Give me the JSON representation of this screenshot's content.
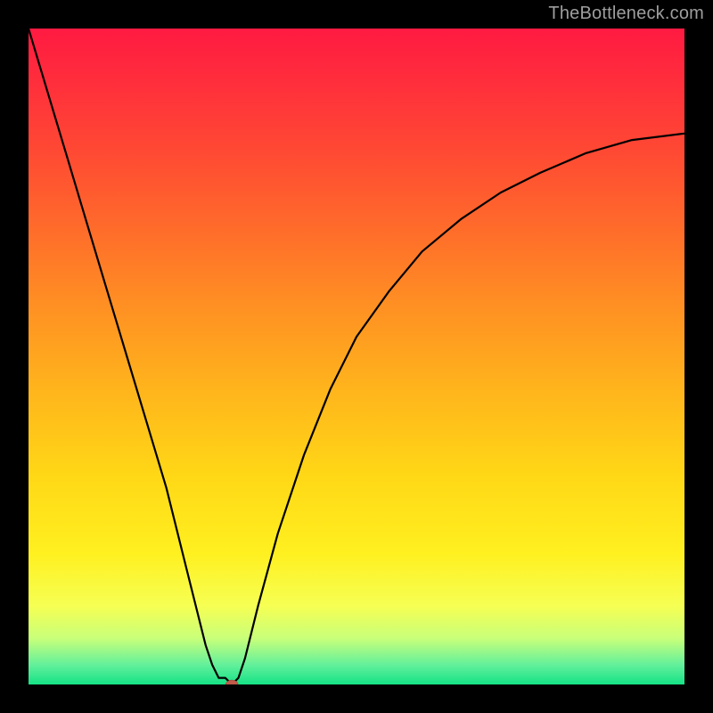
{
  "attribution": "TheBottleneck.com",
  "chart_data": {
    "type": "line",
    "title": "",
    "xlabel": "",
    "ylabel": "",
    "xlim": [
      0,
      100
    ],
    "ylim": [
      0,
      100
    ],
    "grid": false,
    "legend": false,
    "background": {
      "type": "vertical-gradient",
      "stops": [
        {
          "pos": 0.0,
          "color": "#ff1a41"
        },
        {
          "pos": 0.08,
          "color": "#ff2e3c"
        },
        {
          "pos": 0.18,
          "color": "#ff4734"
        },
        {
          "pos": 0.3,
          "color": "#ff6a2b"
        },
        {
          "pos": 0.42,
          "color": "#ff8f23"
        },
        {
          "pos": 0.55,
          "color": "#ffb41c"
        },
        {
          "pos": 0.68,
          "color": "#ffd716"
        },
        {
          "pos": 0.8,
          "color": "#fff020"
        },
        {
          "pos": 0.88,
          "color": "#f6ff53"
        },
        {
          "pos": 0.93,
          "color": "#c8ff7a"
        },
        {
          "pos": 0.97,
          "color": "#63f09b"
        },
        {
          "pos": 1.0,
          "color": "#15e286"
        }
      ]
    },
    "series": [
      {
        "name": "bottleneck-curve",
        "x": [
          0,
          3,
          6,
          9,
          12,
          15,
          18,
          21,
          24,
          27,
          28,
          29,
          30,
          31,
          32,
          33,
          35,
          38,
          42,
          46,
          50,
          55,
          60,
          66,
          72,
          78,
          85,
          92,
          100
        ],
        "values": [
          100,
          90,
          80,
          70,
          60,
          50,
          40,
          30,
          18,
          6,
          3,
          1,
          1,
          0,
          1,
          4,
          12,
          23,
          35,
          45,
          53,
          60,
          66,
          71,
          75,
          78,
          81,
          83,
          84
        ]
      }
    ],
    "marker": {
      "x": 31,
      "y": 0,
      "shape": "pill",
      "color": "#c05a4a"
    }
  }
}
